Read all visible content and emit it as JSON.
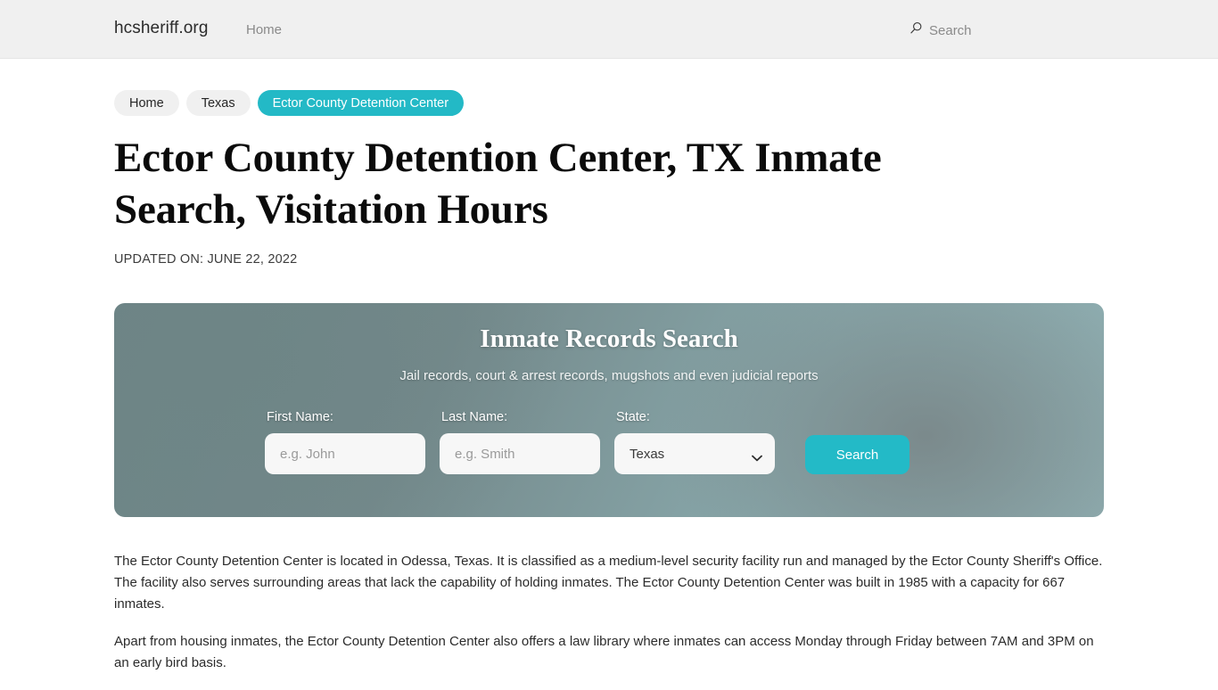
{
  "header": {
    "brand": "hcsheriff.org",
    "nav_home": "Home",
    "search_label": "Search",
    "search_icon": "search-icon"
  },
  "breadcrumb": {
    "items": [
      {
        "label": "Home",
        "active": false
      },
      {
        "label": "Texas",
        "active": false
      },
      {
        "label": "Ector County Detention Center",
        "active": true
      }
    ]
  },
  "page": {
    "title": "Ector County Detention Center, TX Inmate Search, Visitation Hours",
    "updated": "UPDATED ON: JUNE 22, 2022"
  },
  "hero": {
    "title": "Inmate Records Search",
    "subtitle": "Jail records, court & arrest records, mugshots and even judicial reports",
    "first_name": {
      "label": "First Name:",
      "placeholder": "e.g. John",
      "value": ""
    },
    "last_name": {
      "label": "Last Name:",
      "placeholder": "e.g. Smith",
      "value": ""
    },
    "state": {
      "label": "State:",
      "selected": "Texas"
    },
    "search_button": "Search"
  },
  "content": {
    "paragraphs": [
      "The Ector County Detention Center is located in Odessa, Texas. It is classified as a medium-level security facility run and managed by the Ector County Sheriff's Office. The facility also serves surrounding areas that lack the capability of holding inmates. The Ector County Detention Center was built in 1985 with a capacity for 667 inmates.",
      "Apart from housing inmates, the Ector County Detention Center also offers a law library where inmates can access Monday through Friday between 7AM and 3PM on an early bird basis."
    ]
  },
  "colors": {
    "accent_teal": "#23bac7",
    "pill_gray": "#f0f0f0",
    "header_bg": "#f0f0f0",
    "text_dark": "#2b2b2b"
  }
}
